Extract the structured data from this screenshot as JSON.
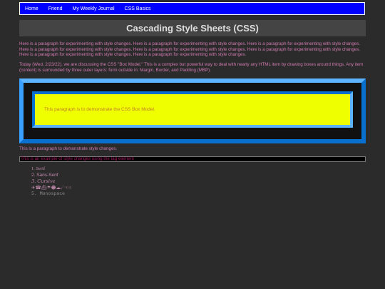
{
  "nav": {
    "items": [
      {
        "label": "Home"
      },
      {
        "label": "Friend"
      },
      {
        "label": "My Weekly Journal"
      },
      {
        "label": "CSS Basics"
      }
    ]
  },
  "header": {
    "title": "Cascading Style Sheets (CSS)"
  },
  "content": {
    "paragraph1": "Here is a paragraph for experimenting with style changes. Here is a paragraph for experimenting with style changes. Here is a paragraph for experimenting with style changes. Here is a paragraph for experimenting with style changes. Here is a paragraph for experimenting with style changes. Here is a paragraph for experimenting with style changes. Here is a paragraph for experimenting with style changes. Here is a paragraph for experimenting with style changes.",
    "paragraph2": "Today (Wed, 2/23/22), we are discussing the CSS \"Box Model.\" This is a complex but powerful way to deal with nearly any HTML item by drawing boxes around things. Any item (content) is surrounded by three outer layers: form outside in: Margin, Border, and Padding (MBP).",
    "box_model_text": "This paragraph is to demonstrate the CSS Box Model.",
    "paragraph3": "This is a paragraph to demonstrate style changes.",
    "span_example": "This is an example of style changes using the tag element",
    "font_list": [
      "1. Serif",
      "2. Sans-Serif",
      "3. Cursive",
      "4. Fantasy",
      "5. Monospace"
    ],
    "fantasy_glyphs": "✈☎⛴☂☻☁☄☜☝"
  },
  "colors": {
    "background": "#2b2b2b",
    "nav_bg": "#0000ff",
    "text_pink": "#d07ab0",
    "box_border": "#1e90ff",
    "box_fill": "#f0ff00"
  }
}
